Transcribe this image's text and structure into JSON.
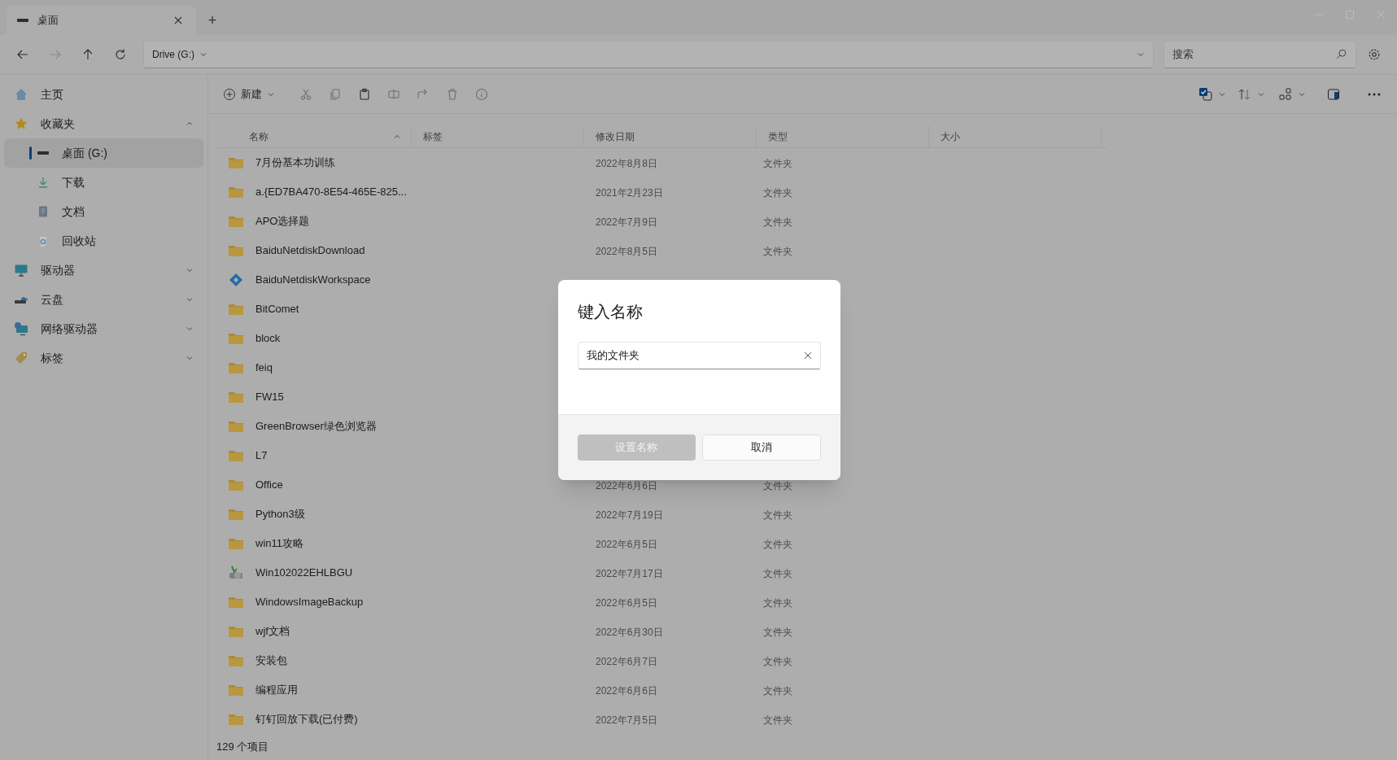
{
  "tabs": [
    {
      "label": "桌面",
      "selected": true
    }
  ],
  "new_tab": "+",
  "address": {
    "segments": [
      "Drive (G:)"
    ]
  },
  "search": {
    "placeholder": "搜索"
  },
  "toolbar": {
    "new_label": "新建"
  },
  "sidebar": {
    "items": [
      {
        "label": "主页",
        "kind": "home",
        "selected": false
      },
      {
        "label": "收藏夹",
        "kind": "star",
        "selected": false,
        "expanded": true,
        "children": [
          {
            "label": "桌面 (G:)",
            "kind": "drive",
            "selected": true
          },
          {
            "label": "下载",
            "kind": "download",
            "selected": false
          },
          {
            "label": "文档",
            "kind": "document",
            "selected": false
          },
          {
            "label": "回收站",
            "kind": "recycle",
            "selected": false
          }
        ]
      },
      {
        "label": "驱动器",
        "kind": "monitor",
        "selected": false,
        "expanded": false
      },
      {
        "label": "云盘",
        "kind": "cloud",
        "selected": false,
        "expanded": false
      },
      {
        "label": "网络驱动器",
        "kind": "network",
        "selected": false,
        "expanded": false
      },
      {
        "label": "标签",
        "kind": "tag",
        "selected": false,
        "expanded": false
      }
    ]
  },
  "table": {
    "columns": [
      {
        "label": "名称",
        "sorted": true
      },
      {
        "label": "标签",
        "sorted": false
      },
      {
        "label": "修改日期",
        "sorted": false
      },
      {
        "label": "类型",
        "sorted": false
      },
      {
        "label": "大小",
        "sorted": false
      }
    ],
    "rows": [
      {
        "kind": "folder",
        "name": "7月份基本功训练",
        "date": "2022年8月8日",
        "type": "文件夹"
      },
      {
        "kind": "folder",
        "name": "a.{ED7BA470-8E54-465E-825...",
        "date": "2021年2月23日",
        "type": "文件夹"
      },
      {
        "kind": "folder",
        "name": "APO选择题",
        "date": "2022年7月9日",
        "type": "文件夹"
      },
      {
        "kind": "folder",
        "name": "BaiduNetdiskDownload",
        "date": "2022年8月5日",
        "type": "文件夹"
      },
      {
        "kind": "sync",
        "name": "BaiduNetdiskWorkspace"
      },
      {
        "kind": "folder",
        "name": "BitComet"
      },
      {
        "kind": "folder",
        "name": "block"
      },
      {
        "kind": "folder",
        "name": "feiq"
      },
      {
        "kind": "folder",
        "name": "FW15"
      },
      {
        "kind": "folder",
        "name": "GreenBrowser绿色浏览器"
      },
      {
        "kind": "folder",
        "name": "L7"
      },
      {
        "kind": "folder",
        "name": "Office",
        "date": "2022年6月6日",
        "type": "文件夹"
      },
      {
        "kind": "folder",
        "name": "Python3级",
        "date": "2022年7月19日",
        "type": "文件夹"
      },
      {
        "kind": "folder",
        "name": "win11攻略",
        "date": "2022年6月5日",
        "type": "文件夹"
      },
      {
        "kind": "installer",
        "name": "Win102022EHLBGU",
        "date": "2022年7月17日",
        "type": "文件夹"
      },
      {
        "kind": "folder",
        "name": "WindowsImageBackup",
        "date": "2022年6月5日",
        "type": "文件夹"
      },
      {
        "kind": "folder",
        "name": "wjf文档",
        "date": "2022年6月30日",
        "type": "文件夹"
      },
      {
        "kind": "folder",
        "name": "安装包",
        "date": "2022年6月7日",
        "type": "文件夹"
      },
      {
        "kind": "folder",
        "name": "编程应用",
        "date": "2022年6月6日",
        "type": "文件夹"
      },
      {
        "kind": "folder",
        "name": "钉钉回放下载(已付费)",
        "date": "2022年7月5日",
        "type": "文件夹"
      }
    ]
  },
  "status_bar": "129 个项目",
  "dialog": {
    "title": "键入名称",
    "value": "我的文件夹",
    "confirm": {
      "label": "设置名称",
      "disabled": true
    },
    "cancel": {
      "label": "取消",
      "disabled": false
    }
  }
}
